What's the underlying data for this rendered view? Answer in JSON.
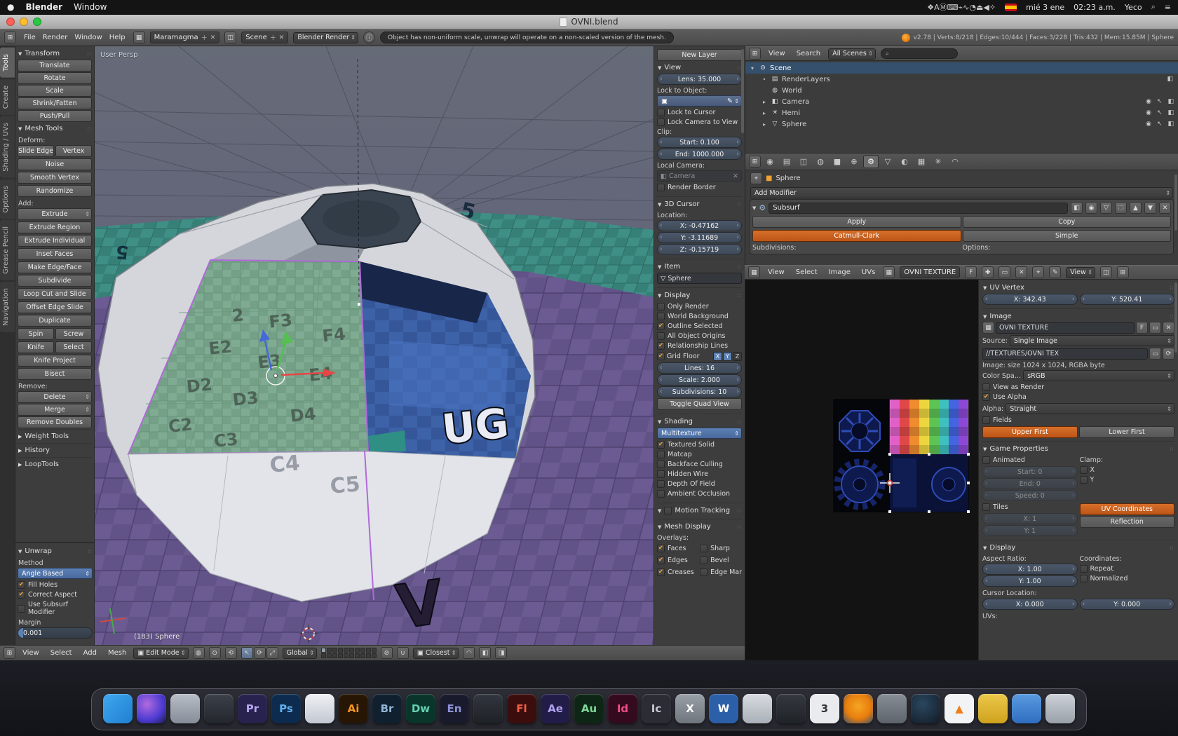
{
  "menubar": {
    "apple_icon": "●",
    "app_name": "Blender",
    "window_menu": "Window",
    "status_icons": [
      {
        "name": "dropbox-icon",
        "glyph": "❖"
      },
      {
        "name": "alfred-icon",
        "glyph": "A"
      },
      {
        "name": "circle-m-icon",
        "glyph": "Ⓜ"
      },
      {
        "name": "keyboard-icon",
        "glyph": "⌨"
      },
      {
        "name": "display-icon",
        "glyph": "⌁"
      },
      {
        "name": "wifi-icon",
        "glyph": "∿"
      },
      {
        "name": "time-machine-icon",
        "glyph": "◔"
      },
      {
        "name": "eject-icon",
        "glyph": "⏏"
      },
      {
        "name": "volume-icon",
        "glyph": "◀"
      },
      {
        "name": "bluetooth-icon",
        "glyph": "✧"
      }
    ],
    "date": "mié 3 ene",
    "time": "02:23 a.m.",
    "user": "Yeco"
  },
  "titlebar": {
    "title": "OVNI.blend"
  },
  "info_header": {
    "menus": [
      "File",
      "Render",
      "Window",
      "Help"
    ],
    "layout_name": "Maramagma",
    "scene_name": "Scene",
    "engine": "Blender Render",
    "warning": "Object has non-uniform scale, unwrap will operate on a non-scaled version of the mesh.",
    "stats": "v2.78 | Verts:8/218 | Edges:10/444 | Faces:3/228 | Tris:432 | Mem:15.85M | Sphere"
  },
  "left_tabs": [
    {
      "label": "Tools",
      "active": true
    },
    {
      "label": "Create",
      "active": false
    },
    {
      "label": "Shading / UVs",
      "active": false
    },
    {
      "label": "Options",
      "active": false
    },
    {
      "label": "Grease Pencil",
      "active": false
    },
    {
      "label": "Navigation",
      "active": false
    }
  ],
  "tool_shelf": {
    "transform_title": "Transform",
    "transform_buttons": [
      {
        "label": "Translate"
      },
      {
        "label": "Rotate"
      },
      {
        "label": "Scale"
      },
      {
        "label": "Shrink/Fatten"
      },
      {
        "label": "Push/Pull"
      }
    ],
    "mesh_tools_title": "Mesh Tools",
    "deform_label": "Deform:",
    "deform_buttons": [
      {
        "label": "Slide Edge",
        "half": true
      },
      {
        "label": "Vertex",
        "half": true
      },
      {
        "label": "Noise"
      },
      {
        "label": "Smooth Vertex"
      },
      {
        "label": "Randomize"
      }
    ],
    "add_label": "Add:",
    "add_buttons": [
      {
        "label": "Extrude",
        "menu": true
      },
      {
        "label": "Extrude Region"
      },
      {
        "label": "Extrude Individual"
      },
      {
        "label": "Inset Faces"
      },
      {
        "label": "Make Edge/Face"
      },
      {
        "label": "Subdivide"
      },
      {
        "label": "Loop Cut and Slide"
      },
      {
        "label": "Offset Edge Slide"
      },
      {
        "label": "Duplicate"
      },
      {
        "label": "Spin",
        "half": true
      },
      {
        "label": "Screw",
        "half": true
      },
      {
        "label": "Knife",
        "half": true
      },
      {
        "label": "Select",
        "half": true
      },
      {
        "label": "Knife Project"
      },
      {
        "label": "Bisect"
      }
    ],
    "remove_label": "Remove:",
    "remove_buttons": [
      {
        "label": "Delete",
        "menu": true
      },
      {
        "label": "Merge",
        "menu": true
      },
      {
        "label": "Remove Doubles"
      }
    ],
    "collapsed_panels": [
      {
        "label": "Weight Tools"
      },
      {
        "label": "History"
      },
      {
        "label": "LoopTools"
      }
    ],
    "unwrap_title": "Unwrap",
    "method_label": "Method",
    "method_value": "Angle Based",
    "unwrap_options": [
      {
        "label": "Fill Holes",
        "checked": true
      },
      {
        "label": "Correct Aspect",
        "checked": true
      },
      {
        "label": "Use Subsurf Modifier",
        "checked": false
      }
    ],
    "margin_label": "Margin",
    "margin_value": "0.001"
  },
  "viewport": {
    "view_label": "User Persp",
    "object_label": "(183) Sphere",
    "face_labels": [
      "2",
      "F3",
      "F4",
      "E2",
      "E3",
      "E4",
      "D2",
      "D3",
      "D4",
      "C2",
      "C3",
      "C4",
      "C5"
    ],
    "ground_labels": [
      "C5",
      "5",
      "5",
      "UG",
      "V"
    ]
  },
  "npanel": {
    "new_layer": "New Layer",
    "view": {
      "title": "View",
      "lens": "Lens: 35.000",
      "lock_object_label": "Lock to Object:",
      "lock_cursor": "Lock to Cursor",
      "lock_camera": "Lock Camera to View",
      "clip_label": "Clip:",
      "clip_start": "Start: 0.100",
      "clip_end": "End: 1000.000",
      "local_camera_label": "Local Camera:",
      "local_camera": "Camera",
      "render_border": "Render Border"
    },
    "cursor3d": {
      "title": "3D Cursor",
      "location_label": "Location:",
      "x": "X: -0.47162",
      "y": "Y: -3.11689",
      "z": "Z: -0.15719"
    },
    "item": {
      "title": "Item",
      "name": "Sphere"
    },
    "display": {
      "title": "Display",
      "options": [
        {
          "label": "Only Render",
          "checked": false
        },
        {
          "label": "World Background",
          "checked": false
        },
        {
          "label": "Outline Selected",
          "checked": true
        },
        {
          "label": "All Object Origins",
          "checked": false
        },
        {
          "label": "Relationship Lines",
          "checked": true
        }
      ],
      "grid_floor_label": "Grid Floor",
      "grid_floor_checked": true,
      "axes": [
        {
          "label": "X",
          "on": true
        },
        {
          "label": "Y",
          "on": true
        },
        {
          "label": "Z",
          "on": false
        }
      ],
      "lines": "Lines: 16",
      "scale": "Scale: 2.000",
      "subdivisions": "Subdivisions: 10",
      "toggle_quad": "Toggle Quad View"
    },
    "shading": {
      "title": "Shading",
      "mode": "Multitexture",
      "options": [
        {
          "label": "Textured Solid",
          "checked": true
        },
        {
          "label": "Matcap",
          "checked": false
        },
        {
          "label": "Backface Culling",
          "checked": false
        },
        {
          "label": "Hidden Wire",
          "checked": false
        },
        {
          "label": "Depth Of Field",
          "checked": false
        },
        {
          "label": "Ambient Occlusion",
          "checked": false
        }
      ]
    },
    "motion_tracking": {
      "title": "Motion Tracking",
      "checked": false
    },
    "mesh_display": {
      "title": "Mesh Display",
      "overlays_label": "Overlays:",
      "overlays": [
        {
          "label": "Faces",
          "checked": true
        },
        {
          "label": "Sharp",
          "checked": false
        },
        {
          "label": "Edges",
          "checked": true
        },
        {
          "label": "Bevel",
          "checked": false
        },
        {
          "label": "Creases",
          "checked": true
        },
        {
          "label": "Edge Mar",
          "checked": false
        }
      ]
    }
  },
  "outliner": {
    "menus": [
      "View",
      "Search"
    ],
    "scope": "All Scenes",
    "rows": [
      {
        "label": "Scene",
        "exp": "▾",
        "icon": "⊙",
        "style": "padding-left:5px",
        "selected": true,
        "toggles": false,
        "cam": false
      },
      {
        "label": "RenderLayers",
        "exp": "•",
        "icon": "▤",
        "style": "padding-left:22px",
        "selected": false,
        "toggles": false,
        "cam": true
      },
      {
        "label": "World",
        "exp": "",
        "icon": "◍",
        "style": "padding-left:22px",
        "selected": false,
        "toggles": false,
        "cam": false
      },
      {
        "label": "Camera",
        "exp": "▸",
        "icon": "◧",
        "style": "padding-left:22px",
        "selected": false,
        "toggles": true,
        "cam": false
      },
      {
        "label": "Hemi",
        "exp": "▸",
        "icon": "☀",
        "style": "padding-left:22px",
        "selected": false,
        "toggles": true,
        "cam": false
      },
      {
        "label": "Sphere",
        "exp": "▸",
        "icon": "▽",
        "style": "padding-left:22px",
        "selected": false,
        "toggles": true,
        "cam": false
      }
    ]
  },
  "properties": {
    "tabs": [
      {
        "name": "render-tab",
        "glyph": "◉",
        "active": false
      },
      {
        "name": "render-layers-tab",
        "glyph": "▤",
        "active": false
      },
      {
        "name": "scene-tab",
        "glyph": "◫",
        "active": false
      },
      {
        "name": "world-tab",
        "glyph": "◍",
        "active": false
      },
      {
        "name": "object-tab",
        "glyph": "■",
        "active": false
      },
      {
        "name": "constraints-tab",
        "glyph": "⊕",
        "active": false
      },
      {
        "name": "modifiers-tab",
        "glyph": "⚙",
        "active": true
      },
      {
        "name": "object-data-tab",
        "glyph": "▽",
        "active": false
      },
      {
        "name": "material-tab",
        "glyph": "◐",
        "active": false
      },
      {
        "name": "texture-tab",
        "glyph": "▦",
        "active": false
      },
      {
        "name": "particles-tab",
        "glyph": "✳",
        "active": false
      },
      {
        "name": "physics-tab",
        "glyph": "◠",
        "active": false
      }
    ],
    "breadcrumb": "Sphere",
    "add_modifier": "Add Modifier",
    "modifier": {
      "name": "Subsurf",
      "apply": "Apply",
      "copy": "Copy",
      "algo_active": "Catmull-Clark",
      "algo_alt": "Simple",
      "subdivisions_label": "Subdivisions:",
      "options_label": "Options:"
    }
  },
  "uv_editor": {
    "menus": [
      "View",
      "Select",
      "Image",
      "UVs"
    ],
    "image_name": "OVNI TEXTURE",
    "fake_user": "F",
    "view_dropdown": "View",
    "panel": {
      "uv_vertex_title": "UV Vertex",
      "x": "X: 342.43",
      "y": "Y: 520.41",
      "image_title": "Image",
      "image_name": "OVNI TEXTURE",
      "fake_user": "F",
      "source_label": "Source:",
      "source": "Single Image",
      "filepath": "//TEXTURES/OVNI TEX",
      "info": "Image: size 1024 x 1024, RGBA byte",
      "colorspace_label": "Color Spa…",
      "colorspace": "sRGB",
      "view_as_render": "View as Render",
      "use_alpha": "Use Alpha",
      "alpha_label": "Alpha:",
      "alpha": "Straight",
      "fields": "Fields",
      "upper_first": "Upper First",
      "lower_first": "Lower First",
      "game_title": "Game Properties",
      "animated": "Animated",
      "clamp_label": "Clamp:",
      "clamp_x": "X",
      "clamp_y": "Y",
      "gstart": "Start: 0",
      "gend": "End: 0",
      "gspeed": "Speed: 0",
      "tiles": "Tiles",
      "tiles_x": "X: 1",
      "tiles_y": "Y: 1",
      "uv_coords": "UV Coordinates",
      "reflection": "Reflection",
      "display_title": "Display",
      "aspect_label": "Aspect Ratio:",
      "coords_label": "Coordinates:",
      "ax": "X: 1.00",
      "ay": "Y: 1.00",
      "repeat": "Repeat",
      "normalized": "Normalized",
      "cursor_label": "Cursor Location:",
      "cx": "X: 0.000",
      "cy": "Y: 0.000",
      "uvs_label": "UVs:"
    }
  },
  "footer": {
    "menus": [
      "View",
      "Select",
      "Add",
      "Mesh"
    ],
    "mode": "Edit Mode",
    "orientation": "Global",
    "snap": "Closest",
    "layers": [
      {
        "on": true
      },
      {
        "on": false
      },
      {
        "on": false
      },
      {
        "on": false
      },
      {
        "on": false
      },
      {
        "on": false
      },
      {
        "on": false
      },
      {
        "on": false
      },
      {
        "on": false
      },
      {
        "on": false
      },
      {
        "on": false
      },
      {
        "on": false
      },
      {
        "on": false
      },
      {
        "on": false
      },
      {
        "on": false
      },
      {
        "on": false
      },
      {
        "on": false
      },
      {
        "on": false
      },
      {
        "on": false
      },
      {
        "on": false
      }
    ]
  },
  "dock": {
    "icons": [
      {
        "name": "finder-icon",
        "label": "",
        "css": "background:linear-gradient(135deg,#3fa8f0,#1f7fd0)"
      },
      {
        "name": "siri-icon",
        "label": "",
        "css": "background:radial-gradient(circle at 35% 35%,#b06ae0,#4a3ad0 60%,#1a1a40)"
      },
      {
        "name": "launchpad-icon",
        "label": "",
        "css": "background:linear-gradient(#b8bdc6,#868d98)"
      },
      {
        "name": "dark-app-icon",
        "label": "",
        "css": "background:linear-gradient(#3c414a,#23262c)"
      },
      {
        "name": "premiere-icon",
        "label": "Pr",
        "css": "background:#28224e;color:#b9a8f0"
      },
      {
        "name": "photoshop-icon",
        "label": "Ps",
        "css": "background:#0c2b4e;color:#63b1f0"
      },
      {
        "name": "preview-icon",
        "label": "",
        "css": "background:linear-gradient(#eef0f4,#c3c9d2)"
      },
      {
        "name": "illustrator-icon",
        "label": "Ai",
        "css": "background:#261603;color:#f29422"
      },
      {
        "name": "bridge-icon",
        "label": "Br",
        "css": "background:#10202e;color:#8fb4d6"
      },
      {
        "name": "dreamweaver-icon",
        "label": "Dw",
        "css": "background:#0a352a;color:#66d0b2"
      },
      {
        "name": "encore-icon",
        "label": "En",
        "css": "background:#191a2c;color:#8f92d8"
      },
      {
        "name": "dark-app-2-icon",
        "label": "",
        "css": "background:linear-gradient(#32363e,#1e2126)"
      },
      {
        "name": "flash-icon",
        "label": "Fl",
        "css": "background:#3c0d0d;color:#f0604a"
      },
      {
        "name": "after-effects-icon",
        "label": "Ae",
        "css": "background:#221d48;color:#b0a0f0"
      },
      {
        "name": "audition-icon",
        "label": "Au",
        "css": "background:#0e2616;color:#7fd89a"
      },
      {
        "name": "indesign-icon",
        "label": "Id",
        "css": "background:#340a1e;color:#f04e86"
      },
      {
        "name": "incopy-icon",
        "label": "Ic",
        "css": "background:#2c2c34;color:#c8ccd4"
      },
      {
        "name": "grey-app-icon",
        "label": "X",
        "css": "background:linear-gradient(#9aa0a8,#70767e);color:#fff"
      },
      {
        "name": "word-icon",
        "label": "W",
        "css": "background:#2b5fa8;color:#fff"
      },
      {
        "name": "light-app-icon",
        "label": "",
        "css": "background:linear-gradient(#d8dce2,#aab0b8)"
      },
      {
        "name": "dark-app-3-icon",
        "label": "",
        "css": "background:linear-gradient(#34383f,#202328)"
      },
      {
        "name": "three-app-icon",
        "label": "3",
        "css": "background:#e9ebee;color:#333"
      },
      {
        "name": "blender-dock-icon",
        "label": "",
        "css": "background:radial-gradient(circle at 50% 42%,#f5a623,#e87d0d 55%,#35506e)"
      },
      {
        "name": "grey-app-2-icon",
        "label": "",
        "css": "background:linear-gradient(#888e96,#5e646c)"
      },
      {
        "name": "steam-icon",
        "label": "",
        "css": "background:radial-gradient(circle at 40% 35%,#2a475e,#121b26)"
      },
      {
        "name": "vlc-icon",
        "label": "▲",
        "css": "background:#f2f3f5;color:#ef7d1a"
      },
      {
        "name": "yellow-app-icon",
        "label": "",
        "css": "background:linear-gradient(#ecc84a,#cfa21e)"
      },
      {
        "name": "blue-app-icon",
        "label": "",
        "css": "background:linear-gradient(#5a9ae0,#2f6ec0)"
      },
      {
        "name": "trash-icon",
        "label": "",
        "css": "background:linear-gradient(#cdd2d9,#9aa0a8)"
      }
    ]
  }
}
